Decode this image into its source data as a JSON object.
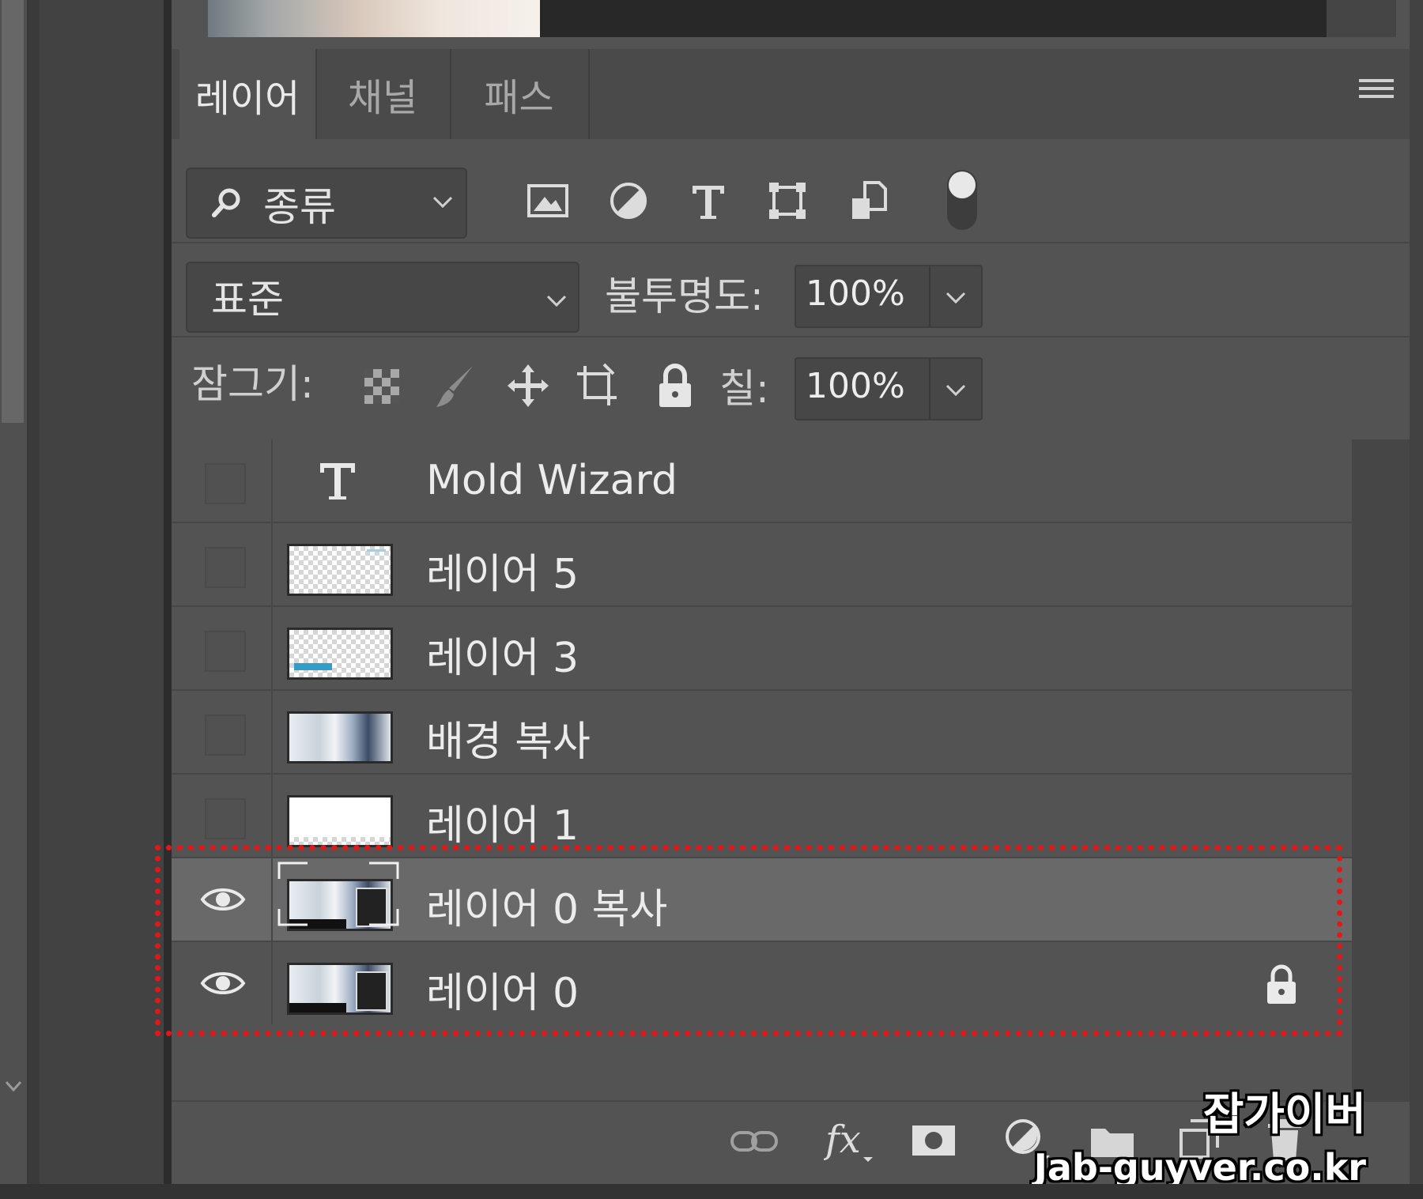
{
  "tabs": [
    {
      "label": "레이어",
      "active": true
    },
    {
      "label": "채널",
      "active": false
    },
    {
      "label": "패스",
      "active": false
    }
  ],
  "filter": {
    "label": "종류"
  },
  "blend": {
    "mode": "표준",
    "opacity_label": "불투명도:",
    "opacity_value": "100%"
  },
  "lock": {
    "label": "잠그기:",
    "fill_label": "칠:",
    "fill_value": "100%"
  },
  "layers": [
    {
      "name": "Mold Wizard",
      "type": "text",
      "visible": false
    },
    {
      "name": "레이어 5",
      "type": "transparent",
      "visible": false
    },
    {
      "name": "레이어 3",
      "type": "transparent",
      "visible": false
    },
    {
      "name": "배경 복사",
      "type": "photo",
      "visible": false
    },
    {
      "name": "레이어 1",
      "type": "white",
      "visible": false
    },
    {
      "name": "레이어 0 복사",
      "type": "smart-object",
      "visible": true,
      "selected": true
    },
    {
      "name": "레이어 0",
      "type": "smart-object",
      "visible": true,
      "locked": true
    }
  ],
  "watermark": {
    "line1": "잡가이버",
    "line2": "Jab-guyver.co.kr"
  },
  "colors": {
    "panel": "#535353",
    "selected_row": "#696969",
    "highlight_outline": "#e21818"
  }
}
